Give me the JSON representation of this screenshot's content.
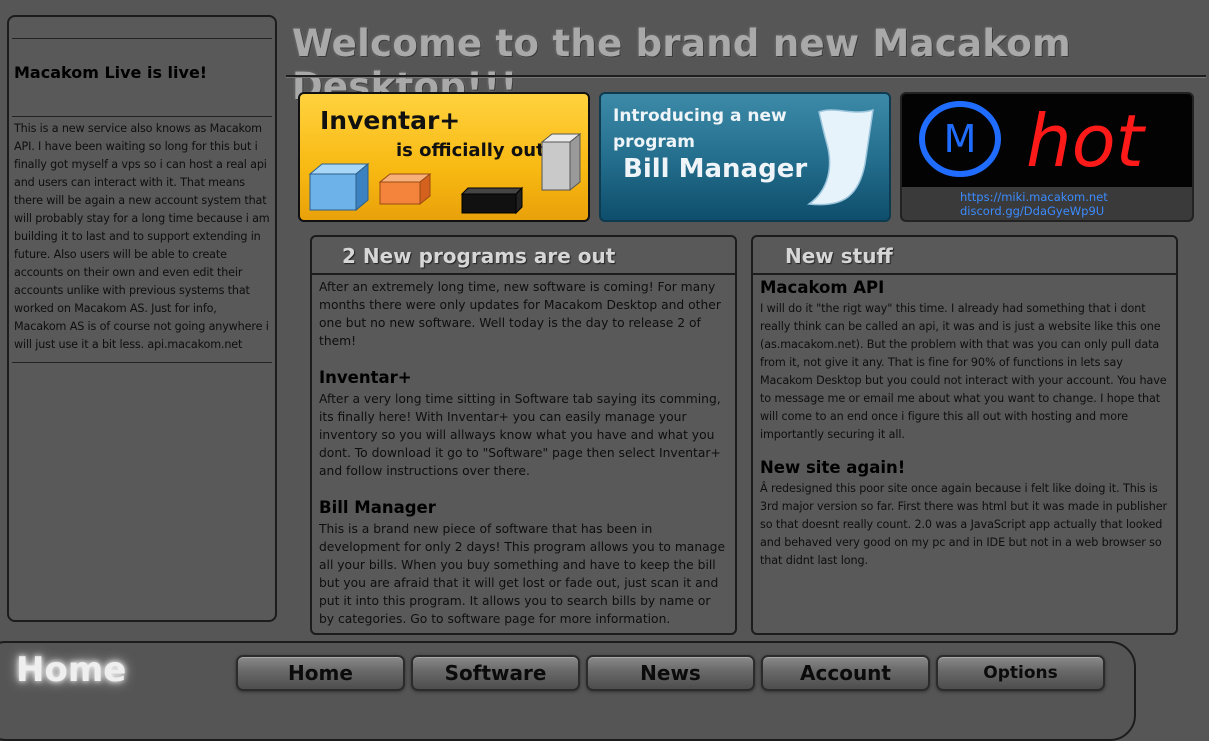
{
  "sidebar": {
    "title": "Macakom Live is live!",
    "body": "This is a new service also knows as Macakom API. I have been waiting so long for this but i finally got myself a vps so i can host a real api and users can interact with it. That means there will be again a new account system that will probably stay for a long time because i am building it to last and to support extending in future. Also users will be able to create accounts on their own and even edit their accounts unlike with previous systems that worked on Macakom AS. Just for info, Macakom AS is of course not going anywhere i will just use it a bit less. api.macakom.net"
  },
  "header": {
    "title": "Welcome to the brand new Macakom Desktop!!!"
  },
  "banners": {
    "inventar": {
      "line1": "Inventar+",
      "line2": "is officially out!"
    },
    "bill": {
      "line1": "Introducing a new",
      "line2": "program",
      "line3": "Bill Manager"
    },
    "hot": {
      "logo_letter": "M",
      "logo_word": "hot",
      "link1": "https://miki.macakom.net",
      "link2": "discord.gg/DdaGyeWp9U"
    }
  },
  "programs_panel": {
    "title": "2 New programs are out",
    "intro": "After an extremely long time, new software is coming! For many months there were only updates for Macakom Desktop and other one but no new software. Well today is the day to release 2 of them!",
    "inventar_title": "Inventar+",
    "inventar_text": "After a very long time sitting in Software tab saying its comming, its finally here! With Inventar+ you can easily manage your inventory so you will allways know what you have and what you dont. To download it go to \"Software\" page then select Inventar+ and follow instructions over there.",
    "bill_title": "Bill Manager",
    "bill_text": "This is a brand new piece of software that has been in development for only 2 days! This program allows you to manage all your bills. When you buy something and have to keep the bill but you are afraid that it will get lost or fade out, just scan it and put it into this program. It allows you to search bills by name or by categories. Go to software page for more information."
  },
  "news_panel": {
    "title": "New stuff",
    "api_title": "Macakom API",
    "api_text": "I will do it \"the rigt way\" this time. I already had something that i dont really think can be called an api, it was and is just a website like this one (as.macakom.net). But the problem with that was you can only pull data from it, not give it any. That is fine for 90% of functions in lets say Macakom Desktop but you could not interact with your account. You have to message me or email me about what you want to change. I hope that will come to an end once i figure this all out with hosting and more importantly securing it all.",
    "site_title": "New site again!",
    "site_text": "Â redesigned this poor site once again because i felt like doing it. This is 3rd major version so far. First there was html but it was made in publisher so that doesnt really count. 2.0 was a JavaScript app actually that looked and behaved very good on my pc and in IDE but not in a web browser so that didnt last long."
  },
  "footer": {
    "current_page": "Home",
    "nav": [
      "Home",
      "Software",
      "News",
      "Account",
      "Options"
    ]
  },
  "colors": {
    "background": "#565656",
    "inventar_banner": "#f8b912",
    "bill_banner": "#256f8e",
    "link": "#3b8bff"
  }
}
